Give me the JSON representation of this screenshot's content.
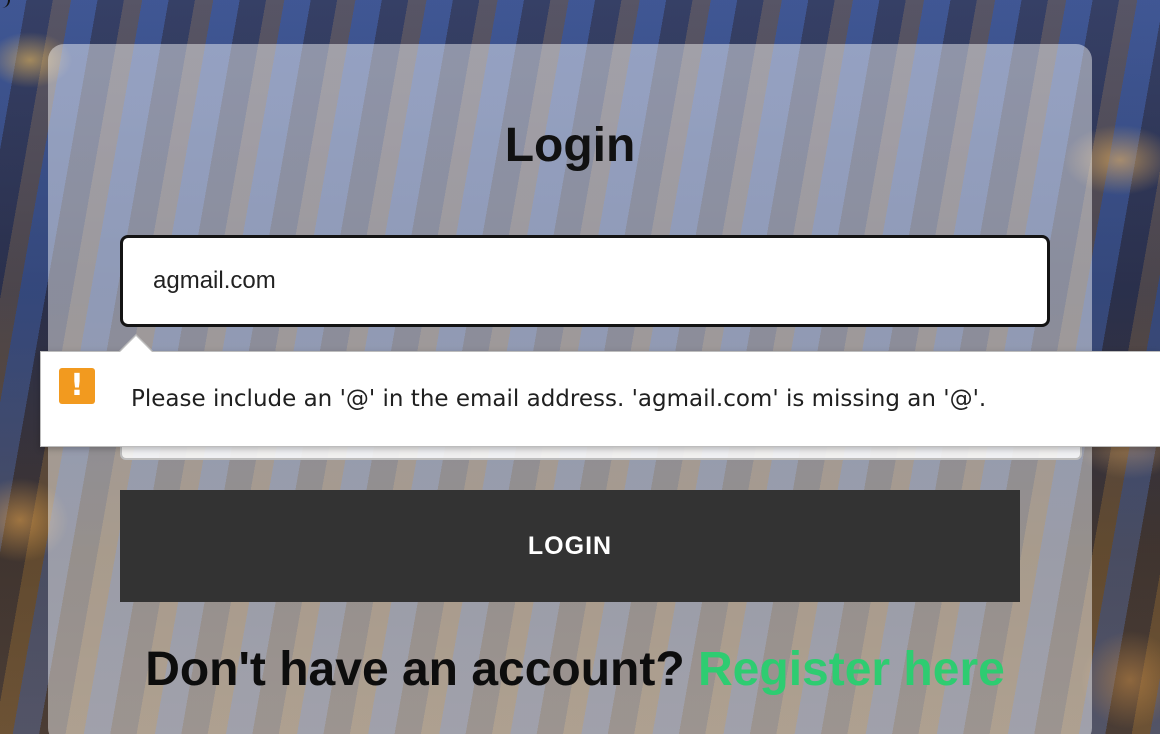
{
  "form": {
    "title": "Login",
    "email_value": "agmail.com",
    "login_label": "LOGIN",
    "register_question": "Don't have an account?",
    "register_link": "Register here"
  },
  "validation_tooltip": {
    "icon": "warning-icon",
    "message": "Please include an '@' in the email address. 'agmail.com' is missing an '@'."
  },
  "colors": {
    "button_bg": "#333333",
    "link": "#2ecc71",
    "warning": "#f29a1f"
  }
}
